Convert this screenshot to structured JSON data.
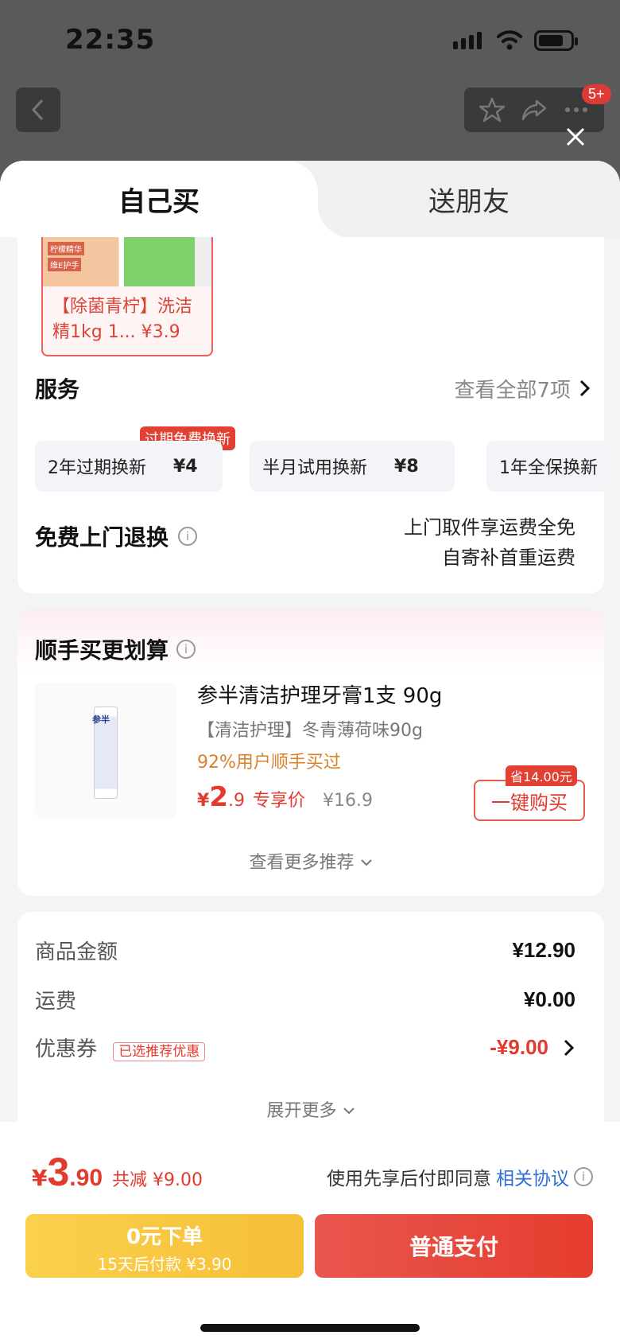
{
  "status": {
    "time": "22:35"
  },
  "nav": {
    "badge": "5+"
  },
  "tabs": {
    "self": "自己买",
    "friend": "送朋友"
  },
  "promo": {
    "thumb_tag1": "柠檬精华",
    "thumb_tag2": "维E护手",
    "text": "【除菌青柠】洗洁精1kg 1... ¥3.9"
  },
  "service": {
    "title": "服务",
    "more": "查看全部7项",
    "chips": [
      {
        "name": "2年过期换新",
        "price": "¥4"
      },
      {
        "name": "半月试用换新",
        "price": "¥8"
      },
      {
        "name": "1年全保换新",
        "price": ""
      }
    ],
    "chip_tag": "过期免费换新",
    "return_title": "免费上门退换",
    "return_line1": "上门取件享运费全免",
    "return_line2": "自寄补首重运费"
  },
  "recommend": {
    "title": "顺手买更划算",
    "product_brand": "参半",
    "product_name": "参半清洁护理牙膏1支 90g",
    "product_sub": "【清洁护理】冬青薄荷味90g",
    "product_buyers": "92%用户顺手买过",
    "price_yen": "¥",
    "price_int": "2",
    "price_dec": ".9",
    "price_label": "专享价",
    "price_orig": "¥16.9",
    "save_tag": "省14.00元",
    "buy_label": "一键购买",
    "see_more": "查看更多推荐"
  },
  "summary": {
    "goods_label": "商品金额",
    "goods_value": "¥12.90",
    "freight_label": "运费",
    "freight_value": "¥0.00",
    "coupon_label": "优惠券",
    "coupon_tag": "已选推荐优惠",
    "coupon_value": "-¥9.00",
    "expand": "展开更多"
  },
  "footer": {
    "total_yen": "¥",
    "total_int": "3",
    "total_dec": ".90",
    "discount": "共减 ¥9.00",
    "agree_text": "使用先享后付即同意",
    "agree_link": "相关协议",
    "later_main": "0元下单",
    "later_sub": "15天后付款 ¥3.90",
    "pay_label": "普通支付"
  },
  "colors": {
    "accent": "#e33a2e",
    "later": "#f5bf37",
    "link": "#2f6fd6"
  },
  "icons": [
    "back-icon",
    "star-icon",
    "share-icon",
    "more-icon",
    "close-icon",
    "chevron-right-icon",
    "info-icon",
    "chevron-down-icon"
  ]
}
